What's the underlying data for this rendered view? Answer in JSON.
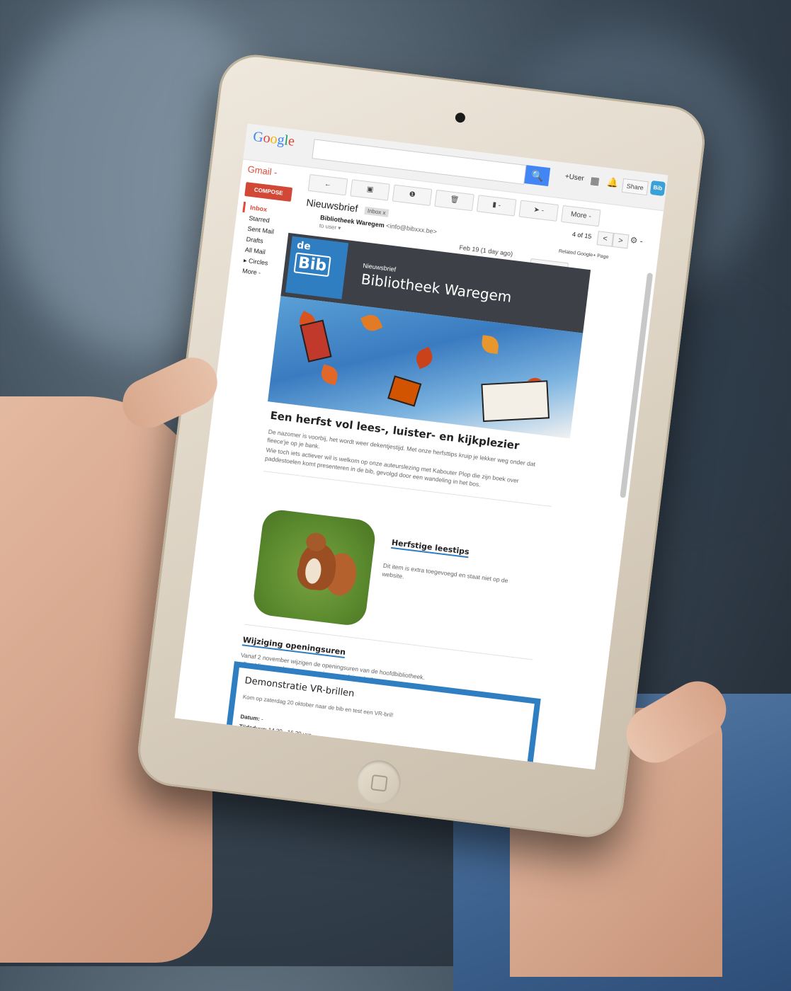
{
  "gmail": {
    "logo": "Google",
    "app_label": "Gmail -",
    "compose": "COMPOSE",
    "nav": [
      "Inbox",
      "Starred",
      "Sent Mail",
      "Drafts",
      "All Mail",
      "▸ Circles",
      "More -"
    ],
    "toolbar": {
      "back": "←",
      "archive": "▣",
      "spam": "❶",
      "delete": "🗑",
      "folder": "▮ -",
      "label": "➤ -",
      "more": "More -"
    },
    "search_button": "🔍",
    "user": "+User",
    "share": "Share",
    "avatar": "Bib",
    "subject": "Nieuwsbrief",
    "inbox_tag": "Inbox x",
    "pager": "4 of 15",
    "pager_prev": "<",
    "pager_next": ">",
    "settings": "⚙ -",
    "sender_name": "Bibliotheek Waregem",
    "sender_email": "<info@bibxxx.be>",
    "to": "to user ▾",
    "date": "Feb 19 (1 day ago)",
    "related": "Related Google+ Page",
    "reply": "↩ ▾"
  },
  "newsletter": {
    "logo_de": "de",
    "logo_bib": "Bib",
    "kicker": "Nieuwsbrief",
    "title": "Bibliotheek Waregem",
    "article1": {
      "heading": "Een herfst vol lees-, luister- en kijkplezier",
      "p1": "De nazomer is voorbij, het wordt weer dekentjestijd. Met onze herfsttips kruip je lekker weg onder dat fleece'je op je bank.",
      "p2": "Wie toch iets actiever wil is welkom op onze auteurslezing met Kabouter Plop die zijn boek over paddestoelen komt presenteren in de bib, gevolgd door een wandeling in het bos."
    },
    "article2": {
      "heading": "Herfstige leestips",
      "text": "Dit item is extra toegevoegd en staat niet op de website."
    },
    "article3": {
      "heading": "Wijziging openingsuren",
      "text": "Vanaf 2 november wijzigen de openingsuren van de hoofdbibliotheek.",
      "image_alt": "afbeelding met de nieuwe openingsuren (zie tekst)"
    },
    "demo": {
      "heading": "Demonstratie VR-brillen",
      "text": "Kom op zaterdag 20 oktober naar de bib en test een VR-bril!",
      "datum_label": "Datum:",
      "datum_value": "-",
      "tijdsduur_label": "Tijdsduur:",
      "tijdsduur_value": "14.30 - 16.30 uur"
    }
  },
  "colors": {
    "brand_blue": "#2f7ec1",
    "header_dark": "#3d4147",
    "gmail_red": "#dd4b39"
  }
}
